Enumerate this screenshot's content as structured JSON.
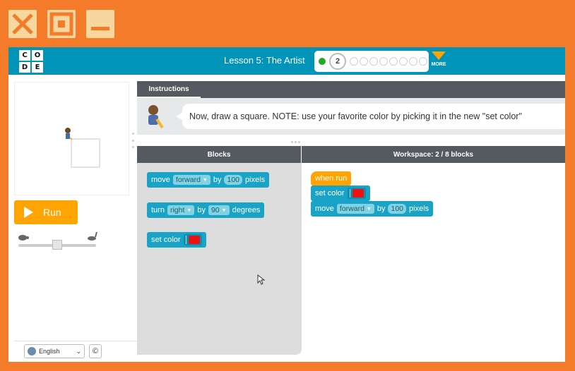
{
  "window": {
    "close_icon": "close-icon",
    "maximize_icon": "maximize-icon",
    "minimize_icon": "minimize-icon",
    "frame_color": "#F37B2A"
  },
  "topbar": {
    "logo_letters": [
      "C",
      "O",
      "D",
      "E"
    ],
    "lesson_title": "Lesson 5: The Artist",
    "progress": {
      "current_level": "2",
      "completed_levels": 1,
      "remaining_levels": 8
    },
    "more_label": "MORE",
    "bar_color": "#0094B8"
  },
  "left": {
    "run_label": "Run",
    "language": "English",
    "copyright_symbol": "©"
  },
  "instructions": {
    "tab_label": "Instructions",
    "text": "Now, draw a square. NOTE: use your favorite color by picking it in the new \"set color\""
  },
  "blocks": {
    "header": "Blocks",
    "move": {
      "verb": "move",
      "dir": "forward",
      "by": "by",
      "amount": "100",
      "unit": "pixels"
    },
    "turn": {
      "verb": "turn",
      "dir": "right",
      "by": "by",
      "amount": "90",
      "unit": "degrees"
    },
    "set_color": {
      "label": "set color",
      "color": "#EE1111"
    }
  },
  "workspace": {
    "header": "Workspace: 2 / 8 blocks",
    "when_run": "when run",
    "set_color": "set color",
    "move": {
      "verb": "move",
      "dir": "forward",
      "by": "by",
      "amount": "100",
      "unit": "pixels"
    }
  },
  "colors": {
    "block_blue": "#18A3C7",
    "event_orange": "#FFA400",
    "run_button": "#FFA400"
  }
}
